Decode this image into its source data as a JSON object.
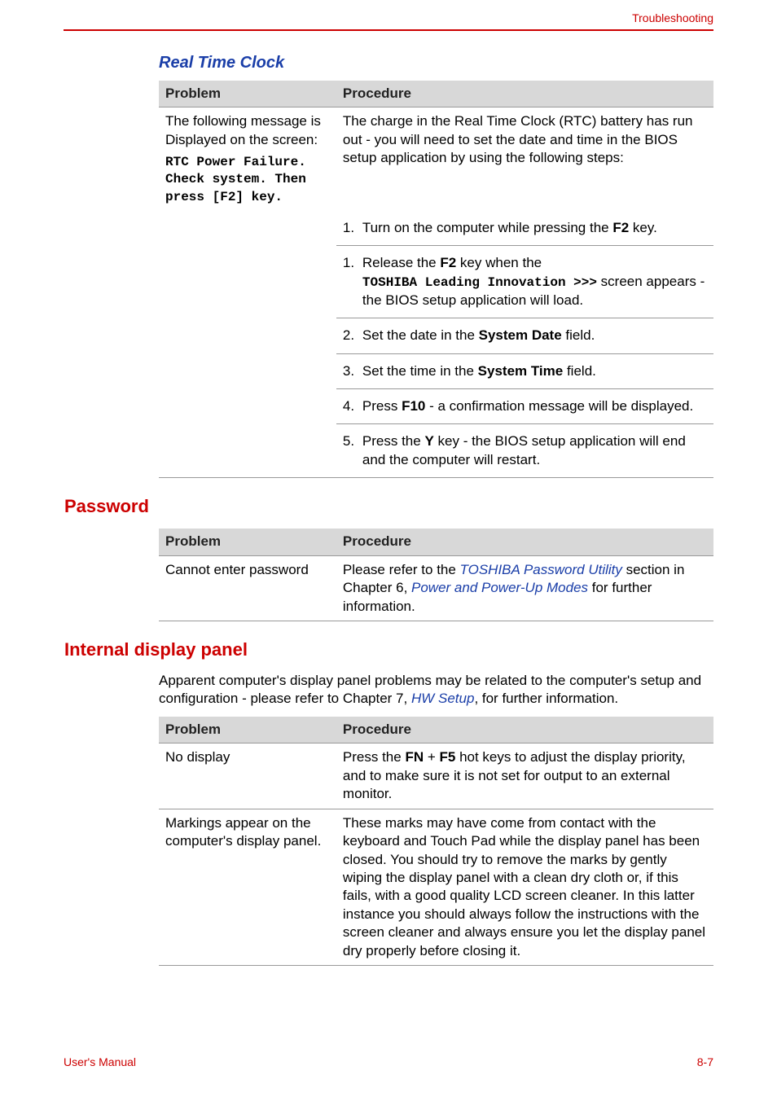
{
  "header": {
    "label": "Troubleshooting"
  },
  "rtc": {
    "heading": "Real Time Clock",
    "col_problem": "Problem",
    "col_procedure": "Procedure",
    "problem_intro": "The following message is Displayed on the screen:",
    "problem_mono": "RTC Power Failure. Check system. Then press [F2] key.",
    "procedure_intro_a": "The charge in the Real Time Clock (RTC) battery has run out - you will need to set the date and time in the BIOS setup application by using the following steps:",
    "step1a_pre": "Turn on the computer while pressing the ",
    "step1a_key": "F2",
    "step1a_post": " key.",
    "step1b_pre": "Release the ",
    "step1b_key": "F2",
    "step1b_mid": " key when the ",
    "step1b_mono": "TOSHIBA Leading Innovation >>>",
    "step1b_post": " screen appears - the BIOS setup application will load.",
    "step2_pre": "Set the date in the ",
    "step2_bold": "System Date",
    "step2_post": " field.",
    "step3_pre": "Set the time in the ",
    "step3_bold": "System Time",
    "step3_post": " field.",
    "step4_pre": "Press ",
    "step4_bold": "F10",
    "step4_post": " - a confirmation message will be displayed.",
    "step5_pre": "Press the ",
    "step5_bold": "Y",
    "step5_post": " key - the BIOS setup application will end and the computer will restart."
  },
  "password": {
    "heading": "Password",
    "col_problem": "Problem",
    "col_procedure": "Procedure",
    "problem": "Cannot enter password",
    "proc_a": "Please refer to the ",
    "link1": "TOSHIBA Password Utility",
    "proc_b": " section in Chapter 6, ",
    "link2": "Power and Power-Up Modes",
    "proc_c": " for further information."
  },
  "display": {
    "heading": "Internal display panel",
    "intro_a": "Apparent computer's display panel problems may be related to the computer's setup and configuration - please refer to Chapter 7, ",
    "intro_link": "HW Setup",
    "intro_b": ", for further information.",
    "col_problem": "Problem",
    "col_procedure": "Procedure",
    "row1_problem": "No display",
    "row1_proc_a": "Press the ",
    "row1_bold": "FN",
    "row1_plus": " + ",
    "row1_bold2": "F5",
    "row1_proc_b": " hot keys to adjust the display priority, and to make sure it is not set for output to an external monitor.",
    "row2_problem": "Markings appear on the computer's display panel.",
    "row2_proc": "These marks may have come from contact with the keyboard and Touch Pad while the display panel has been closed. You should try to remove the marks by gently wiping the display panel with a clean dry cloth or, if this fails, with a good quality LCD screen cleaner. In this latter instance you should always follow the instructions with the screen cleaner and always ensure you let the display panel dry properly before closing it."
  },
  "footer": {
    "left": "User's Manual",
    "right": "8-7"
  }
}
